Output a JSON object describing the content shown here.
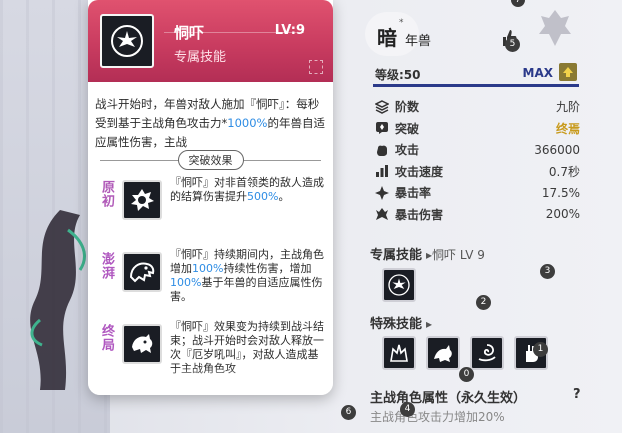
{
  "tooltip": {
    "skill_name": "恫吓",
    "level": "LV:9",
    "skill_type": "专属技能",
    "desc_parts": [
      "战斗开始时，年兽对敌人施加『恫吓』：每秒受到基于主战角色攻击力*",
      "1000%",
      "的年兽自适应属性伤害，主战"
    ],
    "breakthrough_label": "突破效果",
    "stages": [
      {
        "tag": "原初",
        "text_parts": [
          "『恫吓』对非首领类的敌人造成的结算伤害提升",
          "500%",
          "。"
        ]
      },
      {
        "tag": "澎湃",
        "text_parts": [
          "『恫吓』持续期间内，主战角色增加",
          "100%",
          "持续性伤害，增加",
          "100%",
          "基于年兽的自适应属性伤害。"
        ]
      },
      {
        "tag": "终局",
        "text_parts": [
          "『恫吓』效果变为持续到战斗结束；战斗开始时会对敌人释放一次『厄岁吼叫』，对敌人造成基于主战角色攻",
          "",
          ""
        ]
      }
    ]
  },
  "header": {
    "element_char": "暗",
    "element_mark": "*",
    "pet_name": "年兽"
  },
  "level": {
    "label": "等级:50",
    "max_label": "MAX"
  },
  "stats": [
    {
      "icon": "layers-icon",
      "label": "阶数",
      "value": "九阶",
      "gold": false
    },
    {
      "icon": "breakthrough-icon",
      "label": "突破",
      "value": "终焉",
      "gold": true
    },
    {
      "icon": "fist-icon",
      "label": "攻击",
      "value": "366000",
      "gold": false
    },
    {
      "icon": "speed-bars-icon",
      "label": "攻击速度",
      "value": "0.7秒",
      "gold": false
    },
    {
      "icon": "crit-icon",
      "label": "暴击率",
      "value": "17.5%",
      "gold": false
    },
    {
      "icon": "crit-damage-icon",
      "label": "暴击伤害",
      "value": "200%",
      "gold": false
    }
  ],
  "exclusive_skill": {
    "title": "专属技能",
    "subtitle": "▸恫吓 LV 9"
  },
  "special_skill": {
    "title": "特殊技能",
    "arrow": "▸"
  },
  "passive": {
    "title": "主战角色属性（永久生效）",
    "help": "?",
    "desc": "主战角色攻击力增加20%"
  },
  "markers": {
    "m0": "0",
    "m1": "1",
    "m2": "2",
    "m3": "3",
    "m4": "4",
    "m5": "5",
    "m6": "6",
    "m7": "7"
  }
}
